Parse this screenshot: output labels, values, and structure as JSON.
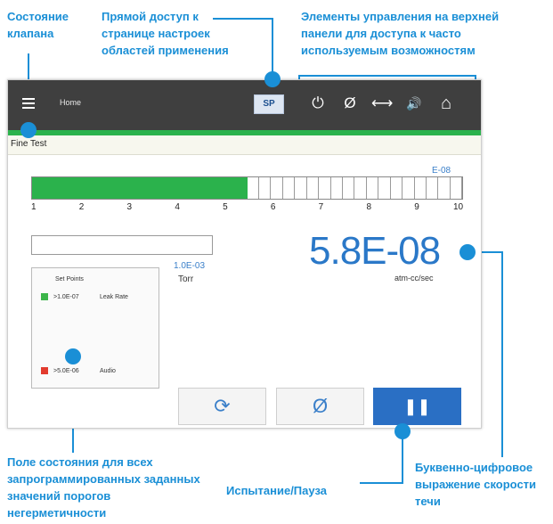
{
  "callouts": {
    "valve_state": "Состояние клапана",
    "direct_access": "Прямой доступ к странице настроек областей применения",
    "top_controls": "Элементы управления на верхней панели для доступа к часто используемым возможностям",
    "status_field": "Поле состояния для всех запрограммированных заданных значений порогов негерметичности",
    "test_pause": "Испытание/Пауза",
    "leak_expression": "Буквенно-цифровое выражение скорости течи"
  },
  "screen": {
    "title": "Home",
    "sp_label": "SP",
    "mode_label": "Fine Test",
    "top_icons": [
      "power-icon",
      "zero-icon",
      "arrows-horizontal-icon",
      "speaker-icon",
      "home-icon"
    ],
    "top_icon_glyphs": [
      "⏻",
      "Ø",
      "⟷",
      "🔊",
      "⌂"
    ],
    "bargraph": {
      "label": "E-08",
      "filled_fraction": 0.5,
      "ticks": [
        "1",
        "2",
        "3",
        "4",
        "5",
        "6",
        "7",
        "8",
        "9",
        "10"
      ]
    },
    "pressure_value": "1.0E-03",
    "pressure_unit": "Torr",
    "leak_rate": "5.8E-08",
    "leak_unit": "atm-cc/sec",
    "setpoints": {
      "title": "Set Points",
      "items": [
        {
          "color": "#3cb54a",
          "value": ">1.0E-07",
          "name": "Leak Rate"
        },
        {
          "color": "#e23b2e",
          "value": ">5.0E-06",
          "name": "Audio"
        }
      ]
    },
    "buttons": {
      "refresh_glyph": "⟳",
      "zero_glyph": "Ø",
      "pause_glyph": "❚❚"
    }
  }
}
